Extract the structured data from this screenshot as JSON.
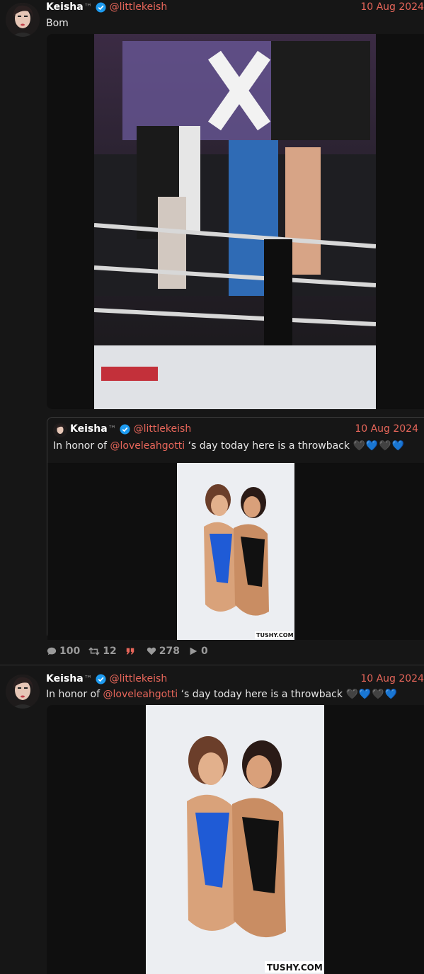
{
  "tweet1": {
    "name": "Keisha",
    "tm": "™",
    "handle": "@littlekeish",
    "date": "10 Aug 2024",
    "text": "Bom",
    "media_desc_icon": "image-boxing-ring",
    "quote": {
      "name": "Keisha",
      "tm": "™",
      "handle": "@littlekeish",
      "date": "10 Aug 2024",
      "text_prefix": "In honor of ",
      "mention": "@loveleahgotti",
      "text_suffix": " ‘s day today here is a throwback ",
      "hearts": "🖤💙🖤💙",
      "media_watermark": "TUSHY.COM"
    },
    "stats": {
      "replies": "100",
      "retweets": "12",
      "quotes": "",
      "likes": "278",
      "views": "0"
    }
  },
  "tweet2": {
    "name": "Keisha",
    "tm": "™",
    "handle": "@littlekeish",
    "date": "10 Aug 2024",
    "text_prefix": "In honor of ",
    "mention": "@loveleahgotti",
    "text_suffix": " ‘s day today here is a throwback ",
    "hearts": "🖤💙🖤💙",
    "media_watermark": "TUSHY.COM"
  },
  "colors": {
    "accent": "#e7665a",
    "background": "#161616",
    "verified": "#1d9bf0"
  }
}
